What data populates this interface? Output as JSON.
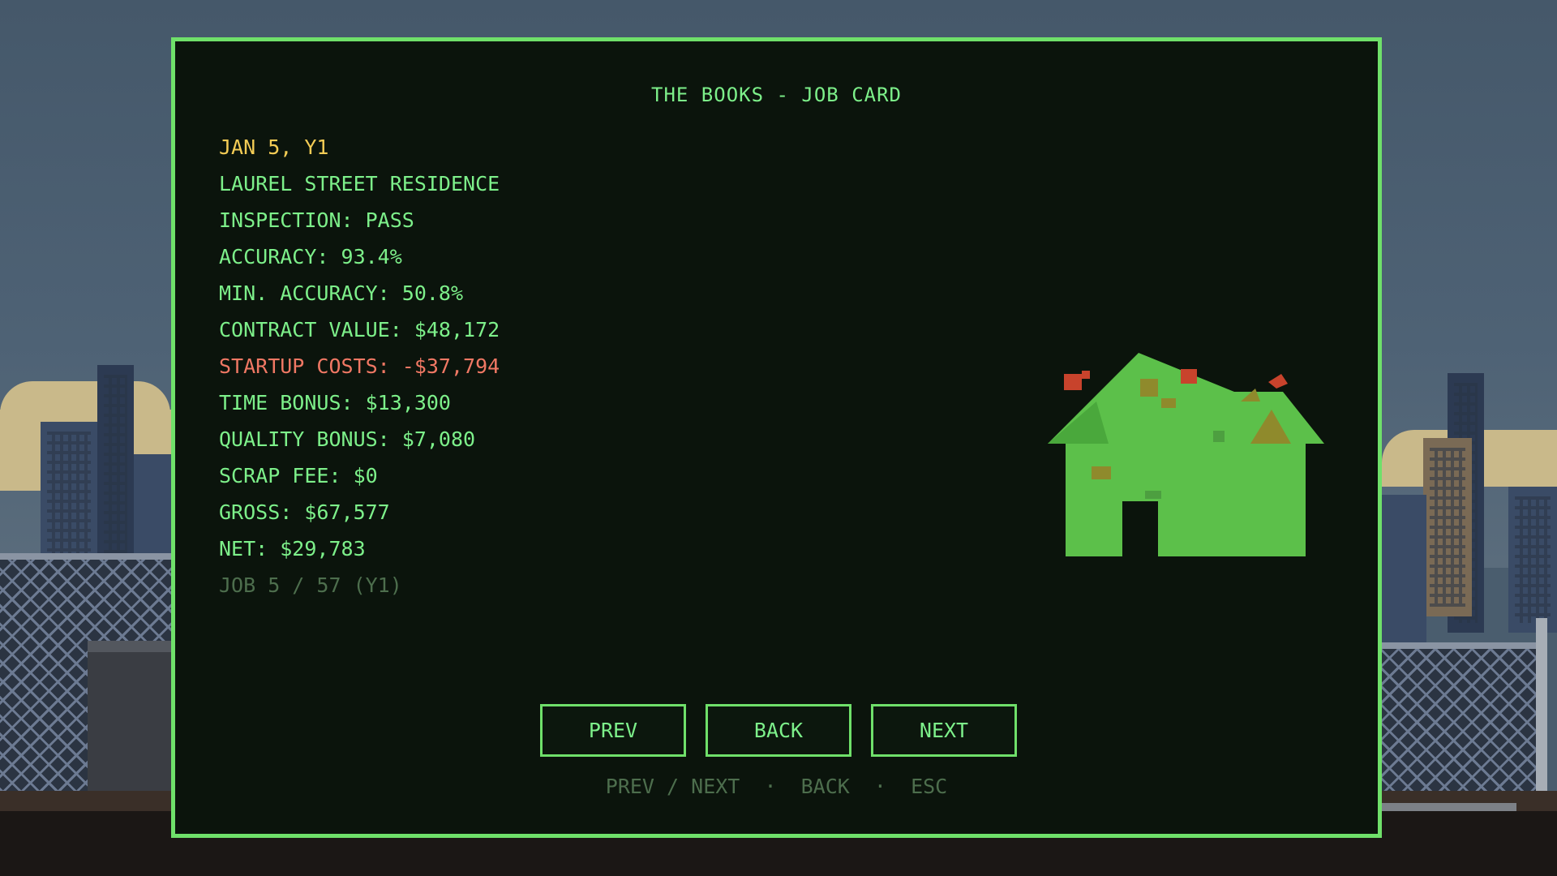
{
  "panel": {
    "title": "THE BOOKS - JOB CARD"
  },
  "job": {
    "date": "JAN 5, Y1",
    "name": "LAUREL STREET RESIDENCE",
    "inspection": "INSPECTION: PASS",
    "accuracy": "ACCURACY: 93.4%",
    "min_accuracy": "MIN. ACCURACY: 50.8%",
    "contract_value": "CONTRACT VALUE: $48,172",
    "startup_costs": "STARTUP COSTS: -$37,794",
    "time_bonus": "TIME BONUS: $13,300",
    "quality_bonus": "QUALITY BONUS: $7,080",
    "scrap_fee": "SCRAP FEE: $0",
    "gross": "GROSS: $67,577",
    "net": "NET: $29,783",
    "position": "JOB 5 / 57  (Y1)"
  },
  "buttons": {
    "prev": "PREV",
    "back": "BACK",
    "next": "NEXT"
  },
  "hint": "PREV / NEXT  ·  BACK  ·  ESC",
  "colors": {
    "accent": "#6fe06a",
    "text": "#7df08a",
    "date": "#f4cc55",
    "negative": "#f07864",
    "dim": "#4d6e4d",
    "panel_bg": "#0b140c"
  },
  "illustration": "house-icon"
}
